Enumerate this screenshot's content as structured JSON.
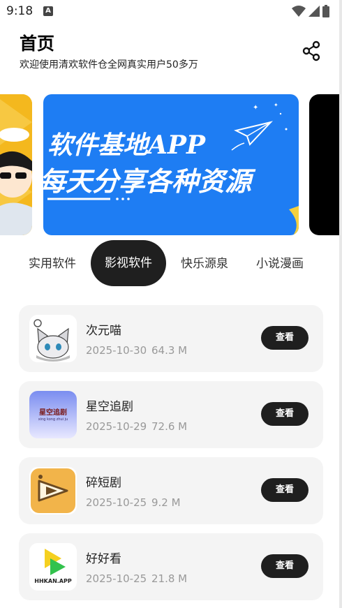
{
  "status": {
    "time": "9:18",
    "notif_letter": "A"
  },
  "header": {
    "title": "首页",
    "subtitle": "欢迎使用清欢软件仓全网真实用户50多万"
  },
  "banner": {
    "line1": "软件基地APP",
    "line2": "每天分享各种资源"
  },
  "tabs": [
    {
      "label": "实用软件",
      "active": false
    },
    {
      "label": "影视软件",
      "active": true
    },
    {
      "label": "快乐源泉",
      "active": false
    },
    {
      "label": "小说漫画",
      "active": false
    }
  ],
  "apps": [
    {
      "name": "次元喵",
      "date": "2025-10-30",
      "size": "64.3 M",
      "button": "查看",
      "icon": "anime-cat-icon"
    },
    {
      "name": "星空追剧",
      "date": "2025-10-29",
      "size": "72.6 M",
      "button": "查看",
      "icon": "star-drama-icon",
      "icon_text": "星空追剧",
      "icon_subtext": "xing kong zhui ju"
    },
    {
      "name": "碎短剧",
      "date": "2025-10-25",
      "size": "9.2 M",
      "button": "查看",
      "icon": "play-clapper-icon"
    },
    {
      "name": "好好看",
      "date": "2025-10-25",
      "size": "21.8 M",
      "button": "查看",
      "icon": "hhkan-logo-icon",
      "icon_text": "HHKAN.APP"
    }
  ],
  "colors": {
    "accent_dark": "#1f1f1f",
    "banner_blue": "#1e7df3",
    "card_bg": "#f4f4f4"
  }
}
